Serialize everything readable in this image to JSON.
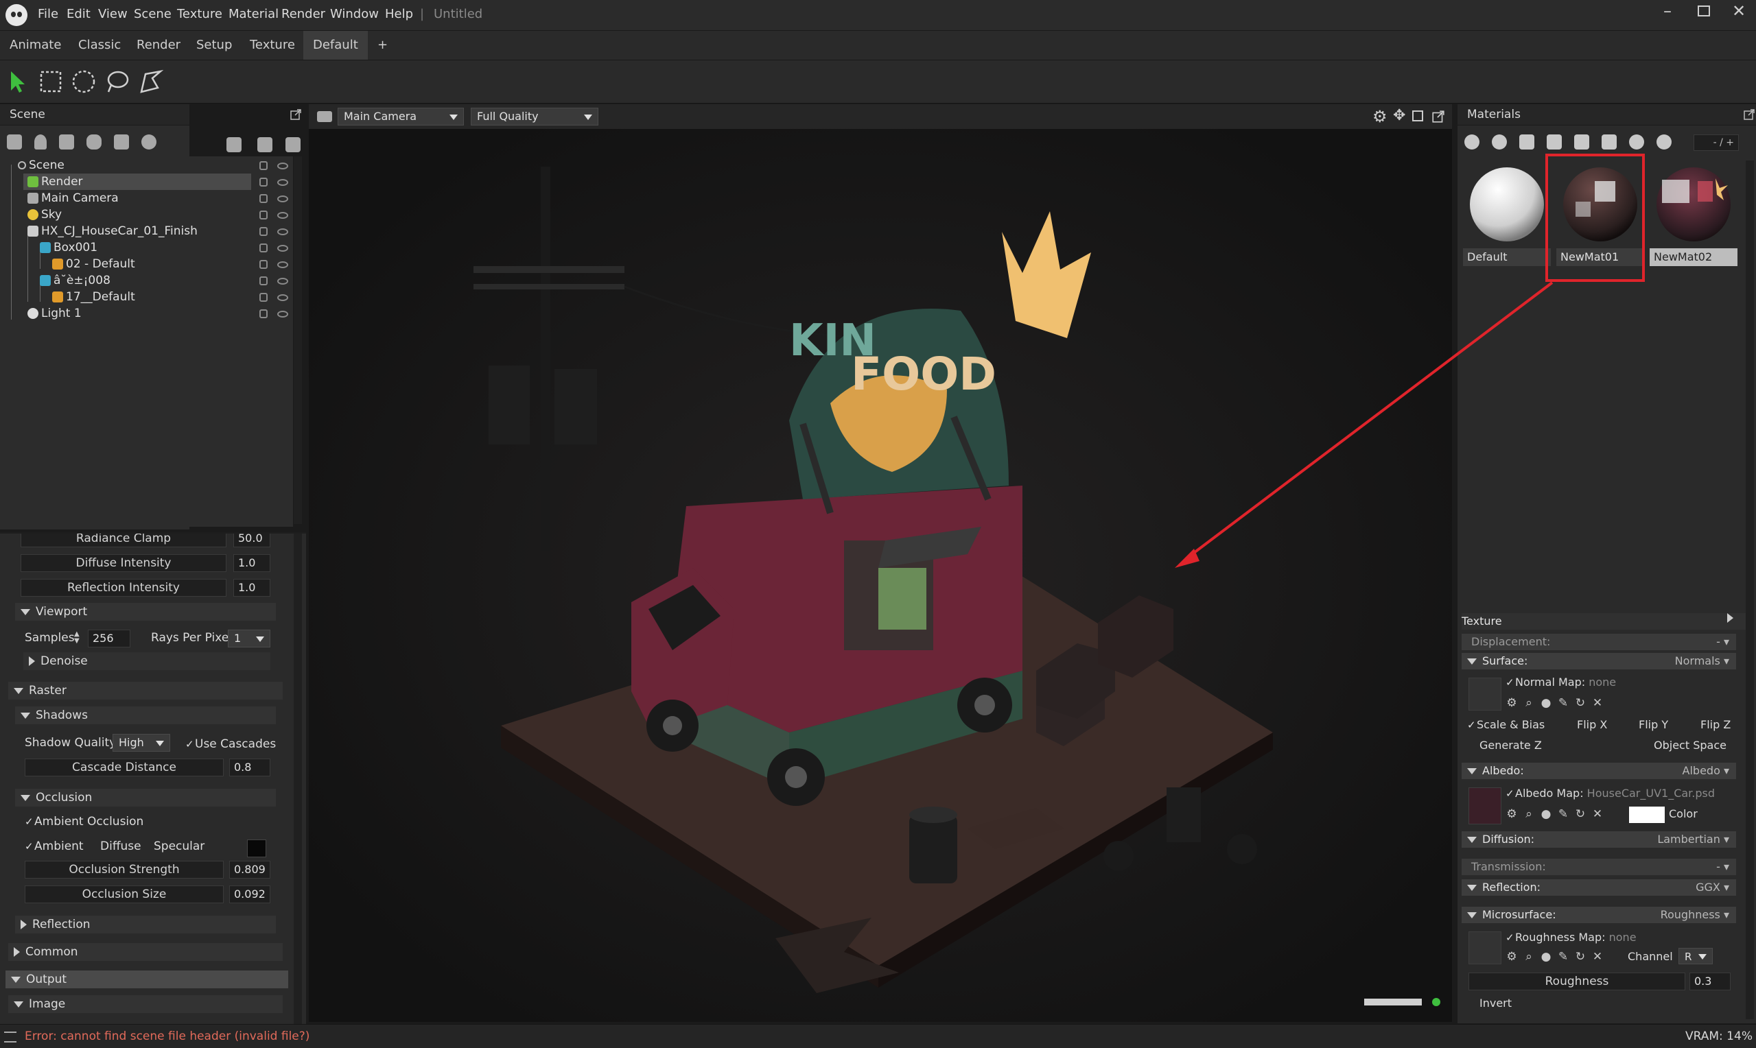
{
  "app": {
    "menu": [
      "File",
      "Edit",
      "View",
      "Scene",
      "Texture",
      "Material",
      "Render",
      "Window",
      "Help"
    ],
    "separator": "|",
    "document_title": "Untitled",
    "window_controls": [
      "minimize",
      "maximize",
      "close"
    ]
  },
  "tabs": [
    "Animate",
    "Classic",
    "Render",
    "Setup",
    "Texture",
    "Default",
    "+"
  ],
  "active_tab": "Default",
  "tools": [
    "select-arrow-icon",
    "rect-select-icon",
    "ellipse-select-icon",
    "lasso-select-icon",
    "pen-select-icon"
  ],
  "scene_panel": {
    "title": "Scene",
    "tree": [
      {
        "label": "Scene",
        "depth": 0,
        "icon": "scene-icon"
      },
      {
        "label": "Render",
        "depth": 1,
        "icon": "render-icon",
        "selected": true
      },
      {
        "label": "Main Camera",
        "depth": 1,
        "icon": "camera-icon"
      },
      {
        "label": "Sky",
        "depth": 1,
        "icon": "sky-icon"
      },
      {
        "label": "HX_CJ_HouseCar_01_Finish",
        "depth": 1,
        "icon": "model-icon"
      },
      {
        "label": "Box001",
        "depth": 2,
        "icon": "mesh-icon"
      },
      {
        "label": "02 - Default",
        "depth": 3,
        "icon": "material-icon"
      },
      {
        "label": "â˘è±¡008",
        "depth": 2,
        "icon": "mesh-icon"
      },
      {
        "label": "17__Default",
        "depth": 3,
        "icon": "material-icon"
      },
      {
        "label": "Light 1",
        "depth": 1,
        "icon": "light-icon"
      }
    ]
  },
  "render_settings": {
    "radiance_clamp": {
      "label": "Radiance Clamp",
      "value": "50.0"
    },
    "diffuse_intensity": {
      "label": "Diffuse Intensity",
      "value": "1.0"
    },
    "reflection_intensity": {
      "label": "Reflection Intensity",
      "value": "1.0"
    },
    "viewport_section": "Viewport",
    "samples_label": "Samples",
    "samples_value": "256",
    "rays_label": "Rays Per Pixel",
    "rays_value": "1",
    "denoise": "Denoise",
    "raster_section": "Raster",
    "shadows_section": "Shadows",
    "shadow_quality_label": "Shadow Quality",
    "shadow_quality_value": "High",
    "use_cascades": "Use Cascades",
    "cascade_distance": {
      "label": "Cascade Distance",
      "value": "0.8"
    },
    "occlusion_section": "Occlusion",
    "ambient_occlusion": "Ambient Occlusion",
    "ambient": "Ambient",
    "diffuse": "Diffuse",
    "specular": "Specular",
    "occlusion_strength": {
      "label": "Occlusion Strength",
      "value": "0.809"
    },
    "occlusion_size": {
      "label": "Occlusion Size",
      "value": "0.092"
    },
    "reflection_section": "Reflection",
    "common_section": "Common",
    "output_section": "Output",
    "image_section": "Image"
  },
  "viewport": {
    "camera": "Main Camera",
    "quality": "Full Quality",
    "scene_text": {
      "kin": "KIN",
      "food": "FOOD"
    }
  },
  "materials_panel": {
    "title": "Materials",
    "page_indicator": "- / +",
    "materials": [
      {
        "name": "Default"
      },
      {
        "name": "NewMat01",
        "highlighted": true
      },
      {
        "name": "NewMat02",
        "selected": true
      }
    ],
    "texture_section": "Texture",
    "displacement": {
      "label": "Displacement:",
      "value": "-"
    },
    "surface": {
      "label": "Surface:",
      "value": "Normals"
    },
    "normal_map_label": "Normal Map:",
    "normal_map_value": "none",
    "scale_bias": "Scale & Bias",
    "flip_x": "Flip X",
    "flip_y": "Flip Y",
    "flip_z": "Flip Z",
    "generate_z": "Generate Z",
    "object_space": "Object Space",
    "albedo": {
      "label": "Albedo:",
      "value": "Albedo"
    },
    "albedo_map_label": "Albedo Map:",
    "albedo_map_value": "HouseCar_UV1_Car.psd",
    "color_label": "Color",
    "diffusion": {
      "label": "Diffusion:",
      "value": "Lambertian"
    },
    "transmission": {
      "label": "Transmission:",
      "value": "-"
    },
    "reflection": {
      "label": "Reflection:",
      "value": "GGX"
    },
    "microsurface": {
      "label": "Microsurface:",
      "value": "Roughness"
    },
    "roughness_map_label": "Roughness Map:",
    "roughness_map_value": "none",
    "channel_label": "Channel",
    "channel_value": "R",
    "roughness": {
      "label": "Roughness",
      "value": "0.3"
    },
    "invert": "Invert"
  },
  "status": {
    "error": "Error: cannot find scene file header (invalid file?)",
    "vram": "VRAM: 14%"
  },
  "colors": {
    "error_text": "#e26a5a",
    "annotation_red": "#e0242b",
    "accent_green": "#3fbf3f"
  }
}
